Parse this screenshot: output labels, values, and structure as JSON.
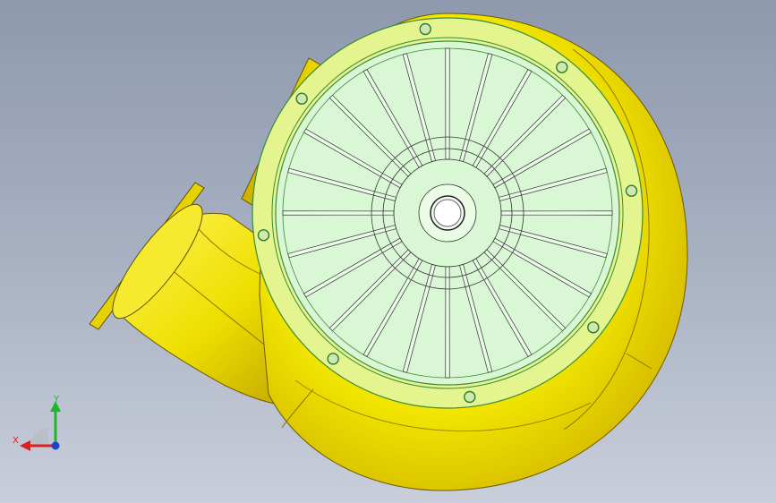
{
  "viewport": {
    "background_top": "#8f99ad",
    "background_bottom": "#c9ceda"
  },
  "model": {
    "description_icon": "centrifugal-fan-icon",
    "housing_color": "#f2ea00",
    "flange_color": "#dff59a",
    "impeller_color": "#d9f7d4",
    "edge_color": "#3c8a3c",
    "blade_count": 24,
    "bolt_count": 8
  },
  "triad": {
    "x_label": "X",
    "y_label": "Y",
    "x_color": "#e0201c",
    "y_color": "#1fb42b",
    "z_color": "#2040d0"
  }
}
